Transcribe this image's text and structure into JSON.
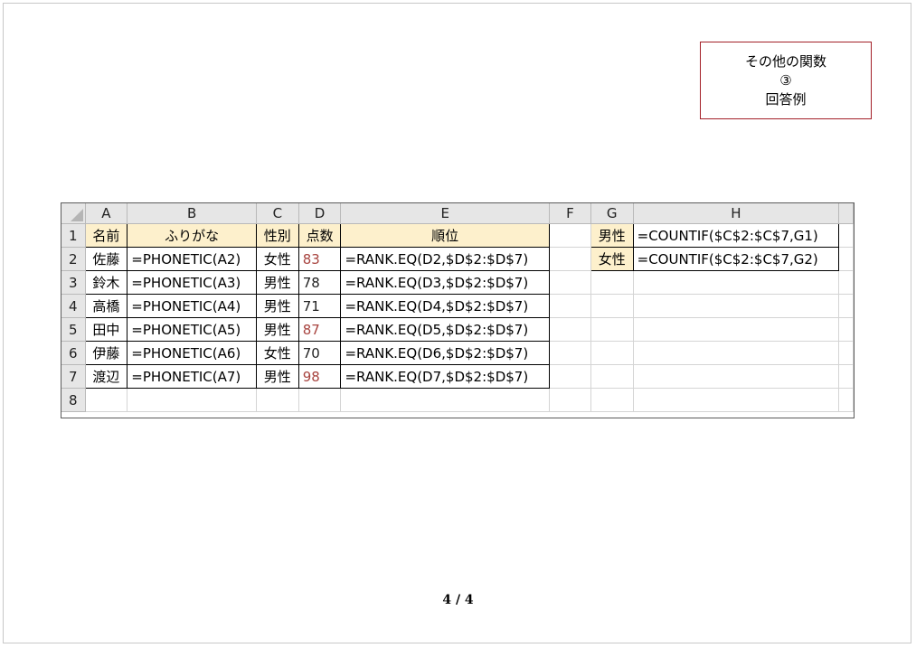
{
  "title_box": {
    "line1": "その他の関数",
    "line2": "③",
    "line3": "回答例"
  },
  "columns": [
    "A",
    "B",
    "C",
    "D",
    "E",
    "F",
    "G",
    "H"
  ],
  "row_numbers": [
    "1",
    "2",
    "3",
    "4",
    "5",
    "6",
    "7",
    "8"
  ],
  "table": {
    "headers": [
      "名前",
      "ふりがな",
      "性別",
      "点数",
      "順位"
    ],
    "rows": [
      [
        "佐藤",
        "=PHONETIC(A2)",
        "女性",
        "83",
        "=RANK.EQ(D2,$D$2:$D$7)"
      ],
      [
        "鈴木",
        "=PHONETIC(A3)",
        "男性",
        "78",
        "=RANK.EQ(D3,$D$2:$D$7)"
      ],
      [
        "高橋",
        "=PHONETIC(A4)",
        "男性",
        "71",
        "=RANK.EQ(D4,$D$2:$D$7)"
      ],
      [
        "田中",
        "=PHONETIC(A5)",
        "男性",
        "87",
        "=RANK.EQ(D5,$D$2:$D$7)"
      ],
      [
        "伊藤",
        "=PHONETIC(A6)",
        "女性",
        "70",
        "=RANK.EQ(D6,$D$2:$D$7)"
      ],
      [
        "渡辺",
        "=PHONETIC(A7)",
        "男性",
        "98",
        "=RANK.EQ(D7,$D$2:$D$7)"
      ]
    ]
  },
  "side_table": [
    {
      "label": "男性",
      "formula": "=COUNTIF($C$2:$C$7,G1)"
    },
    {
      "label": "女性",
      "formula": "=COUNTIF($C$2:$C$7,G2)"
    }
  ],
  "page_indicator": "4 / 4",
  "colors": {
    "header_fill": "#fdf0cc",
    "title_border": "#a31f27",
    "red_score": "#a8443f"
  }
}
